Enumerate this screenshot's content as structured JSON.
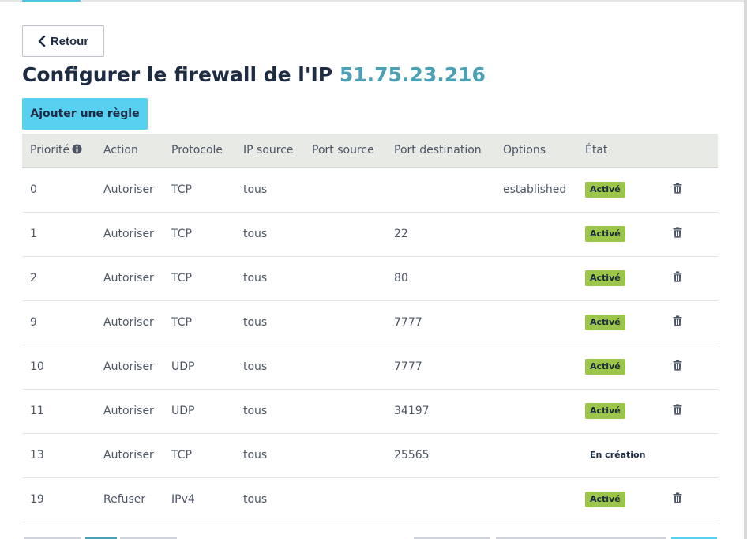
{
  "back_button": {
    "label": "Retour",
    "icon": "chevron-left-icon"
  },
  "title": {
    "prefix": "Configurer le firewall de l'IP",
    "ip": "51.75.23.216"
  },
  "add_rule_button": {
    "label": "Ajouter une règle"
  },
  "colors": {
    "accent": "#4ba0b5",
    "primary_button": "#58d0ef",
    "active_badge": "#9cc64a",
    "header_bg": "#e8eae5"
  },
  "table": {
    "headers": {
      "priority": "Priorité",
      "action": "Action",
      "protocol": "Protocole",
      "source_ip": "IP source",
      "source_port": "Port source",
      "dest_port": "Port destination",
      "options": "Options",
      "state": "État"
    },
    "rows": [
      {
        "priority": "0",
        "action": "Autoriser",
        "protocol": "TCP",
        "source_ip": "tous",
        "source_port": "",
        "dest_port": "",
        "options": "established",
        "state": "Activé",
        "state_kind": "active",
        "deletable": true
      },
      {
        "priority": "1",
        "action": "Autoriser",
        "protocol": "TCP",
        "source_ip": "tous",
        "source_port": "",
        "dest_port": "22",
        "options": "",
        "state": "Activé",
        "state_kind": "active",
        "deletable": true
      },
      {
        "priority": "2",
        "action": "Autoriser",
        "protocol": "TCP",
        "source_ip": "tous",
        "source_port": "",
        "dest_port": "80",
        "options": "",
        "state": "Activé",
        "state_kind": "active",
        "deletable": true
      },
      {
        "priority": "9",
        "action": "Autoriser",
        "protocol": "TCP",
        "source_ip": "tous",
        "source_port": "",
        "dest_port": "7777",
        "options": "",
        "state": "Activé",
        "state_kind": "active",
        "deletable": true
      },
      {
        "priority": "10",
        "action": "Autoriser",
        "protocol": "UDP",
        "source_ip": "tous",
        "source_port": "",
        "dest_port": "7777",
        "options": "",
        "state": "Activé",
        "state_kind": "active",
        "deletable": true
      },
      {
        "priority": "11",
        "action": "Autoriser",
        "protocol": "UDP",
        "source_ip": "tous",
        "source_port": "",
        "dest_port": "34197",
        "options": "",
        "state": "Activé",
        "state_kind": "active",
        "deletable": true
      },
      {
        "priority": "13",
        "action": "Autoriser",
        "protocol": "TCP",
        "source_ip": "tous",
        "source_port": "",
        "dest_port": "25565",
        "options": "",
        "state": "En création",
        "state_kind": "creating",
        "deletable": false
      },
      {
        "priority": "19",
        "action": "Refuser",
        "protocol": "IPv4",
        "source_ip": "tous",
        "source_port": "",
        "dest_port": "",
        "options": "",
        "state": "Activé",
        "state_kind": "active",
        "deletable": true
      }
    ]
  }
}
